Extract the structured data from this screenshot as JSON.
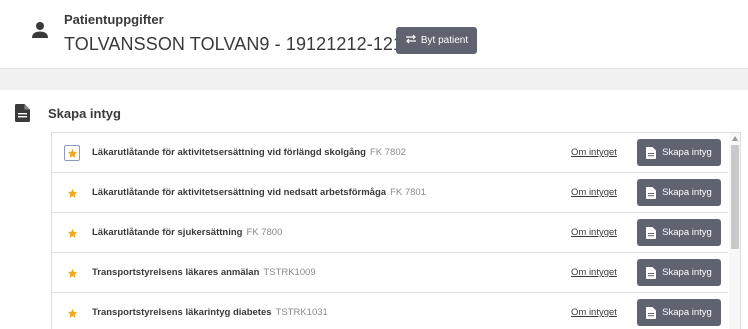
{
  "patient": {
    "section_title": "Patientuppgifter",
    "name_line": "TOLVANSSON TOLVAN9 - 19121212-1212",
    "switch_button_label": "Byt patient"
  },
  "certificates": {
    "section_title": "Skapa intyg",
    "items": [
      {
        "name": "Läkarutlåtande för aktivitetsersättning vid förlängd skolgång",
        "code": "FK 7802",
        "info_link": "Om intyget",
        "create_label": "Skapa intyg"
      },
      {
        "name": "Läkarutlåtande för aktivitetsersättning vid nedsatt arbetsförmåga",
        "code": "FK 7801",
        "info_link": "Om intyget",
        "create_label": "Skapa intyg"
      },
      {
        "name": "Läkarutlåtande för sjukersättning",
        "code": "FK 7800",
        "info_link": "Om intyget",
        "create_label": "Skapa intyg"
      },
      {
        "name": "Transportstyrelsens läkares anmälan",
        "code": "TSTRK1009",
        "info_link": "Om intyget",
        "create_label": "Skapa intyg"
      },
      {
        "name": "Transportstyrelsens läkarintyg diabetes",
        "code": "TSTRK1031",
        "info_link": "Om intyget",
        "create_label": "Skapa intyg"
      }
    ]
  },
  "colors": {
    "button_bg": "#5f6370",
    "star": "#f2a91e",
    "text": "#3a3a3a"
  },
  "icons": {
    "patient": "person-icon",
    "section": "document-icon",
    "switch": "swap-arrows-icon",
    "favorite": "star-icon",
    "create": "document-icon"
  }
}
